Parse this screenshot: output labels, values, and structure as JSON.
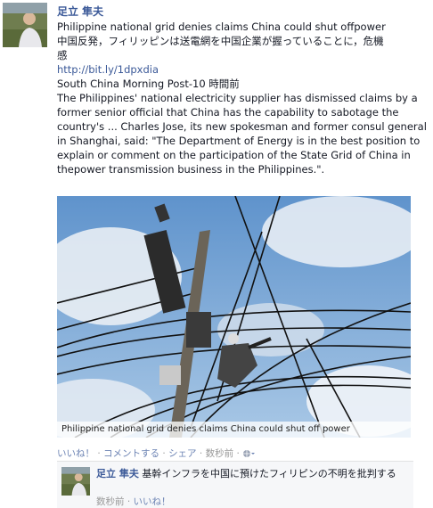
{
  "post": {
    "author": "足立 隼夫",
    "headline": "Philippine national grid denies claims China could shut offpower",
    "jp_line1": "中国反発，フィリッピンは送電網を中国企業が握っていることに，危機",
    "jp_line2": "感",
    "link": "http://bit.ly/1dpxdia",
    "source": "South China Morning Post-10 時間前",
    "body": "The Philippines' national electricity supplier has dismissed claims by a former senior official that China has the capability to sabotage the country's ... Charles Jose, its new spokesman and former consul general in Shanghai, said: \"The Department of Energy is in the best position to explain or comment on the participation of the State Grid of China in thepower transmission business in the Philippines.\".",
    "photo_caption": "Philippine national grid denies claims China could shut off power"
  },
  "actions": {
    "like": "いいね！",
    "comment": "コメントする",
    "share": "シェア",
    "time": "数秒前",
    "dot": "·"
  },
  "comment": {
    "author": "足立 隼夫",
    "text": "基幹インフラを中国に預けたフィリピンの不明を批判する",
    "time": "数秒前",
    "like": "いいね！"
  },
  "colors": {
    "link": "#3b5998",
    "sky": "#7aa6d6"
  }
}
